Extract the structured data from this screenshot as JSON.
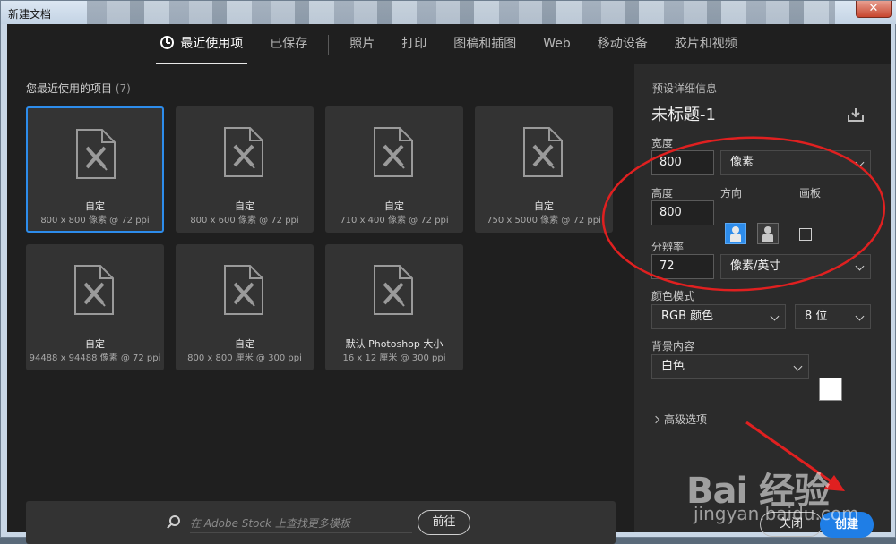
{
  "window": {
    "title": "新建文档",
    "close_glyph": "✕"
  },
  "tabs": [
    {
      "label": "最近使用项",
      "active": true
    },
    {
      "label": "已保存"
    },
    {
      "label": "照片"
    },
    {
      "label": "打印"
    },
    {
      "label": "图稿和插图"
    },
    {
      "label": "Web"
    },
    {
      "label": "移动设备"
    },
    {
      "label": "胶片和视频"
    }
  ],
  "recent": {
    "title": "您最近使用的项目",
    "count": "(7)",
    "items": [
      {
        "name": "自定",
        "meta": "800 x 800 像素 @ 72 ppi"
      },
      {
        "name": "自定",
        "meta": "800 x 600 像素 @ 72 ppi"
      },
      {
        "name": "自定",
        "meta": "710 x 400 像素 @ 72 ppi"
      },
      {
        "name": "自定",
        "meta": "750 x 5000 像素 @ 72 ppi"
      },
      {
        "name": "自定",
        "meta": "94488 x 94488 像素 @ 72 ppi"
      },
      {
        "name": "自定",
        "meta": "800 x 800 厘米 @ 300 ppi"
      },
      {
        "name": "默认 Photoshop 大小",
        "meta": "16 x 12 厘米 @ 300 ppi"
      }
    ]
  },
  "stock": {
    "placeholder": "在 Adobe Stock 上查找更多模板",
    "go_label": "前往"
  },
  "preset": {
    "section_title": "预设详细信息",
    "doc_name": "未标题-1",
    "width_label": "宽度",
    "width_value": "800",
    "width_unit": "像素",
    "height_label": "高度",
    "height_value": "800",
    "orientation_label": "方向",
    "artboard_label": "画板",
    "resolution_label": "分辨率",
    "resolution_value": "72",
    "resolution_unit": "像素/英寸",
    "color_mode_label": "颜色模式",
    "color_mode": "RGB 颜色",
    "bit_depth": "8 位",
    "background_label": "背景内容",
    "background": "白色",
    "background_color": "#ffffff",
    "advanced_label": "高级选项"
  },
  "actions": {
    "close_label": "关闭",
    "create_label": "创建"
  },
  "colors": {
    "accent": "#2d8ceb",
    "annotation": "#e02020"
  },
  "watermark": {
    "main": "Bai 经验",
    "sub": "jingyan.baidu.com"
  }
}
